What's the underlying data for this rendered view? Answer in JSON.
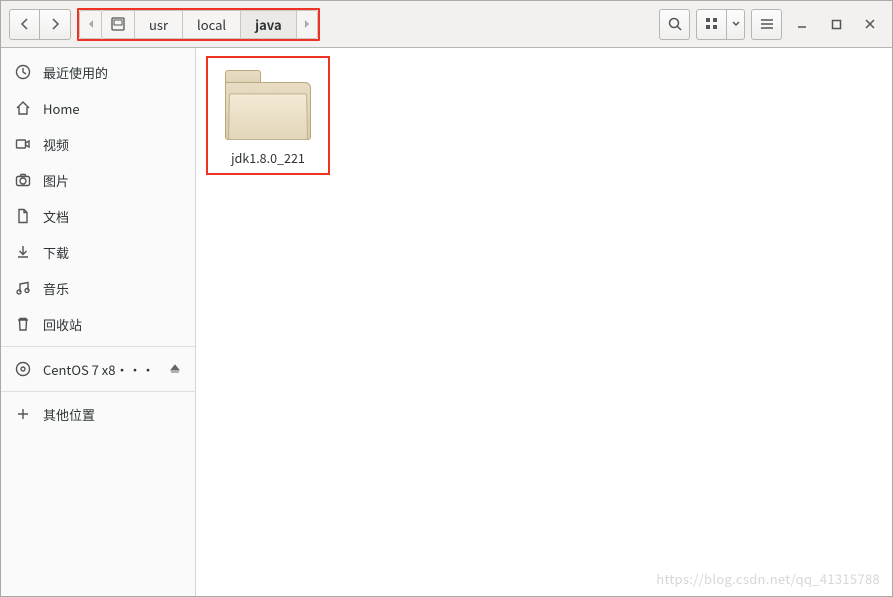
{
  "breadcrumb": {
    "segments": [
      {
        "label": "usr"
      },
      {
        "label": "local"
      },
      {
        "label": "java"
      }
    ]
  },
  "sidebar": {
    "items": [
      {
        "icon": "clock",
        "label": "最近使用的"
      },
      {
        "icon": "home",
        "label": "Home"
      },
      {
        "icon": "video",
        "label": "视频"
      },
      {
        "icon": "camera",
        "label": "图片"
      },
      {
        "icon": "document",
        "label": "文档"
      },
      {
        "icon": "download",
        "label": "下载"
      },
      {
        "icon": "music",
        "label": "音乐"
      },
      {
        "icon": "trash",
        "label": "回收站"
      }
    ],
    "devices": [
      {
        "icon": "disc",
        "label": "CentOS 7 x8···",
        "eject": true
      }
    ],
    "other": [
      {
        "icon": "plus",
        "label": "其他位置"
      }
    ]
  },
  "content": {
    "items": [
      {
        "type": "folder",
        "label": "jdk1.8.0_221",
        "highlighted": true
      }
    ]
  },
  "watermark": "https://blog.csdn.net/qq_41315788"
}
